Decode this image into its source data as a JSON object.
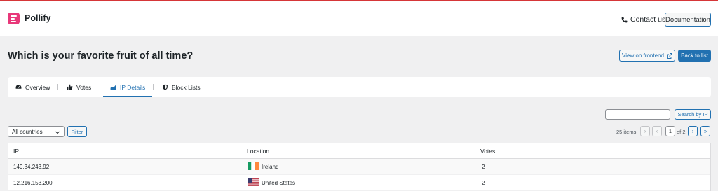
{
  "header": {
    "brand": "Pollify",
    "contact_label": "Contact us",
    "documentation_label": "Documentation"
  },
  "page": {
    "title": "Which is your favorite fruit of all time?",
    "view_frontend_label": "View on frontend",
    "back_label": "Back to list"
  },
  "tabs": [
    {
      "label": "Overview",
      "icon": "dashboard-icon",
      "active": false
    },
    {
      "label": "Votes",
      "icon": "thumbs-up-icon",
      "active": false
    },
    {
      "label": "IP Details",
      "icon": "chart-icon",
      "active": true
    },
    {
      "label": "Block Lists",
      "icon": "shield-icon",
      "active": false
    }
  ],
  "search": {
    "value": "",
    "button_label": "Search by IP"
  },
  "filter": {
    "country_selected": "All countries",
    "button_label": "Filter"
  },
  "pagination": {
    "items_text": "25 items",
    "first": "«",
    "prev": "‹",
    "current_page": "1",
    "of_text": "of 2",
    "next": "›",
    "last": "»"
  },
  "table": {
    "columns": [
      "IP",
      "Location",
      "Votes"
    ],
    "rows": [
      {
        "ip": "149.34.243.92",
        "location": "Ireland",
        "flag": "ireland-flag-icon",
        "votes": "2"
      },
      {
        "ip": "12.216.153.200",
        "location": "United States",
        "flag": "us-flag-icon",
        "votes": "2"
      }
    ]
  },
  "colors": {
    "accent": "#2271b1",
    "brand": "#e8387a",
    "top_line": "#d63638",
    "background": "#f0f0f1"
  }
}
